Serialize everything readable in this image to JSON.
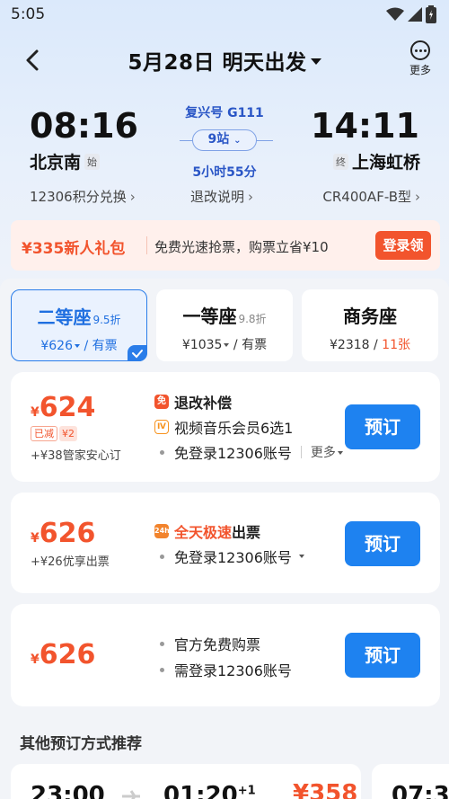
{
  "status": {
    "time": "5:05"
  },
  "nav": {
    "title": "5月28日 明天出发",
    "more_label": "更多"
  },
  "train": {
    "dep_time": "08:16",
    "arr_time": "14:11",
    "dep_station": "北京南",
    "dep_tag": "始",
    "arr_station": "上海虹桥",
    "arr_tag": "终",
    "train_no": "复兴号 G111",
    "stops": "9站",
    "duration": "5小时55分",
    "points_link": "12306积分兑换",
    "refund_link": "退改说明",
    "model_link": "CR400AF-B型"
  },
  "promo": {
    "title": "¥335新人礼包",
    "desc": "免费光速抢票，购票立省¥10",
    "button": "登录领"
  },
  "seats": [
    {
      "name": "二等座",
      "discount": "9.5折",
      "price": "¥626",
      "status": "有票",
      "active": true
    },
    {
      "name": "一等座",
      "discount": "9.8折",
      "price": "¥1035",
      "status": "有票",
      "active": false
    },
    {
      "name": "商务座",
      "discount": "",
      "price": "¥2318",
      "status": "11张",
      "active": false
    }
  ],
  "options": [
    {
      "currency": "¥",
      "price": "624",
      "tag1": "已减",
      "tag2": "¥2",
      "note": "+¥38管家安心订",
      "feature1": "退改补偿",
      "feature2": "视频音乐会员6选1",
      "feature3": "免登录12306账号",
      "more": "更多",
      "button": "预订"
    },
    {
      "currency": "¥",
      "price": "626",
      "note": "+¥26优享出票",
      "feature1_red": "全天极速",
      "feature1_rest": "出票",
      "feature2": "免登录12306账号",
      "button": "预订"
    },
    {
      "currency": "¥",
      "price": "626",
      "feature1": "官方免费购票",
      "feature2": "需登录12306账号",
      "button": "预订"
    }
  ],
  "other_section_title": "其他预订方式推荐",
  "recommend": {
    "dep_time": "23:00",
    "arr_time": "01:20",
    "day_offset": "+1",
    "price": "¥358",
    "right_time": "07:3"
  },
  "colors": {
    "accent": "#1e82f0",
    "price_red": "#f2542d",
    "promo_bg": "#fff0ec"
  },
  "icons": [
    "back-arrow-icon",
    "more-dots-icon",
    "wifi-icon",
    "signal-icon",
    "battery-icon",
    "chevron-right-icon",
    "check-icon",
    "refund-icon",
    "video-icon",
    "speed-24h-icon",
    "plane-icon"
  ]
}
